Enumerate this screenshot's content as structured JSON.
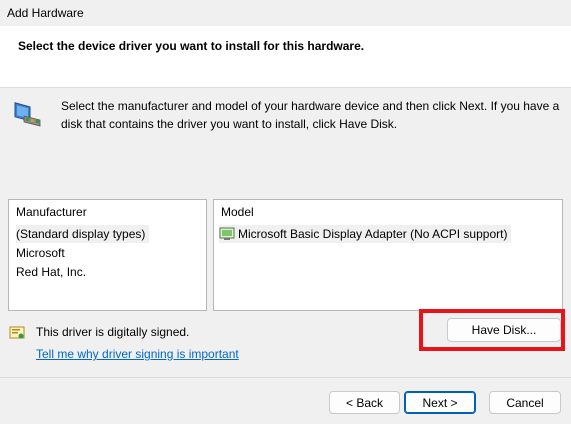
{
  "window": {
    "title": "Add Hardware"
  },
  "header": {
    "text": "Select the device driver you want to install for this hardware."
  },
  "description": "Select the manufacturer and model of your hardware device and then click Next. If you have a disk that contains the driver you want to install, click Have Disk.",
  "manufacturer_list": {
    "header": "Manufacturer",
    "items": [
      "(Standard display types)",
      "Microsoft",
      "Red Hat, Inc."
    ],
    "selected": "(Standard display types)"
  },
  "model_list": {
    "header": "Model",
    "items": [
      "Microsoft Basic Display Adapter (No ACPI support)"
    ],
    "selected": "Microsoft Basic Display Adapter (No ACPI support)"
  },
  "signing": {
    "status": "This driver is digitally signed.",
    "link": "Tell me why driver signing is important"
  },
  "buttons": {
    "have_disk": "Have Disk...",
    "back": "< Back",
    "next": "Next >",
    "cancel": "Cancel"
  },
  "colors": {
    "highlight": "#e8141b",
    "link": "#0066cc",
    "default_button_border": "#005fb8"
  },
  "icons": {
    "hardware": "hardware-device-icon",
    "signed": "signed-driver-icon",
    "display_adapter": "display-adapter-icon"
  }
}
